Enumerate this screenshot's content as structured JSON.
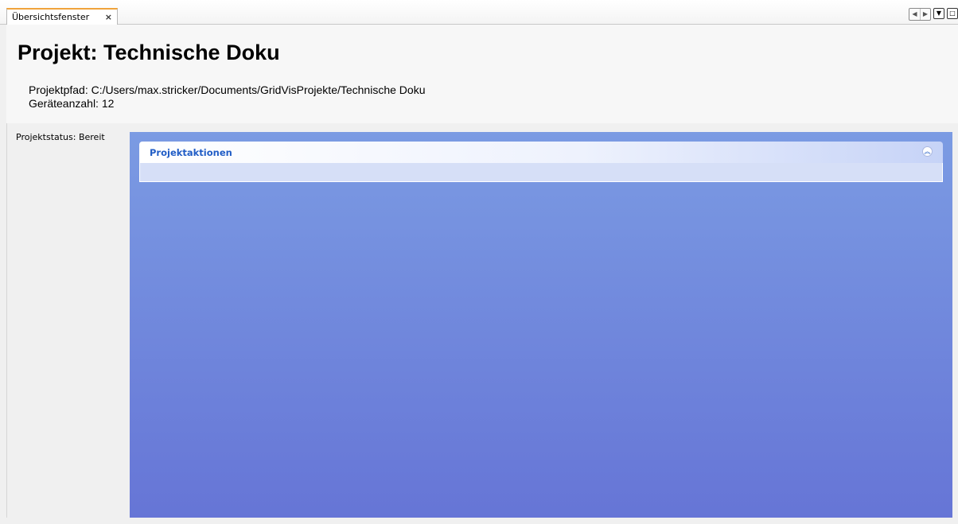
{
  "tab": {
    "label": "Übersichtsfenster",
    "close_glyph": "×"
  },
  "tab_controls": {
    "left_glyph": "◀",
    "right_glyph": "▶",
    "dropdown_glyph": "▼",
    "maximize_glyph": "□"
  },
  "header": {
    "title": "Projekt: Technische Doku",
    "path_line": "Projektpfad: C:/Users/max.stricker/Documents/GridVisProjekte/Technische Doku",
    "count_line": "Geräteanzahl: 12"
  },
  "status": {
    "text": "Projektstatus: Bereit"
  },
  "task_pane": {
    "group_title": "Projektaktionen",
    "collapse_glyph": "︽"
  },
  "colors": {
    "tab_accent": "#f0a33b",
    "pane_top": "#7b9be3",
    "pane_bottom": "#6675d6",
    "group_title": "#215dc6"
  }
}
